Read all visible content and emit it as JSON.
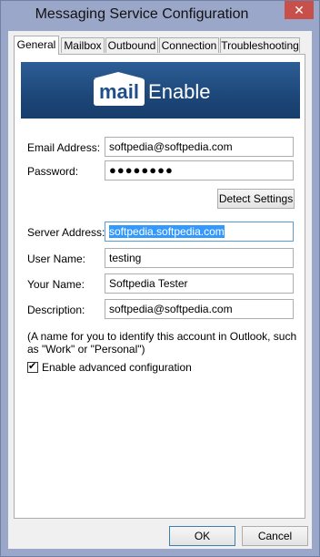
{
  "window": {
    "title": "Messaging Service Configuration",
    "close_glyph": "✕"
  },
  "tabs": [
    {
      "label": "General",
      "active": true
    },
    {
      "label": "Mailbox"
    },
    {
      "label": "Outbound"
    },
    {
      "label": "Connection"
    },
    {
      "label": "Troubleshooting"
    }
  ],
  "banner": {
    "logo_mail": "mail",
    "logo_enable": "Enable"
  },
  "form": {
    "email_label": "Email Address:",
    "email_value": "softpedia@softpedia.com",
    "password_label": "Password:",
    "password_value": "●●●●●●●●",
    "detect_button": "Detect Settings",
    "server_label": "Server Address:",
    "server_value": "softpedia.softpedia.com",
    "username_label": "User Name:",
    "username_value": "testing",
    "yourname_label": "Your Name:",
    "yourname_value": "Softpedia Tester",
    "description_label": "Description:",
    "description_value": "softpedia@softpedia.com",
    "note": "(A name for you to identify this account in Outlook, such as \"Work\" or \"Personal\")",
    "advanced_label": "Enable advanced configuration",
    "advanced_checked": true
  },
  "buttons": {
    "ok": "OK",
    "cancel": "Cancel"
  },
  "colors": {
    "selection": "#3399ff",
    "banner": "#1d4779",
    "close": "#c7504a"
  }
}
